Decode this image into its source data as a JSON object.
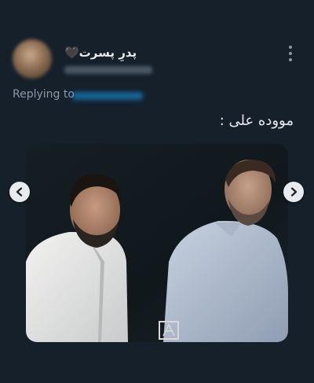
{
  "tweet": {
    "author": {
      "display_name": "پدرِ پسرت🖤",
      "handle": ""
    },
    "replying_to_label": "Replying to",
    "replying_to_handle": "",
    "text": "مووده علی :",
    "media": {
      "image_type": "photo-two-men-talking",
      "watermark": "logo"
    },
    "carousel": {
      "prev_icon": "chevron-left-icon",
      "next_icon": "chevron-right-icon"
    },
    "more_icon": "more-vertical-icon"
  },
  "colors": {
    "background": "#15202b",
    "text": "#e7e9ea",
    "secondary_text": "#8b98a5",
    "link": "#1d9bf0"
  }
}
